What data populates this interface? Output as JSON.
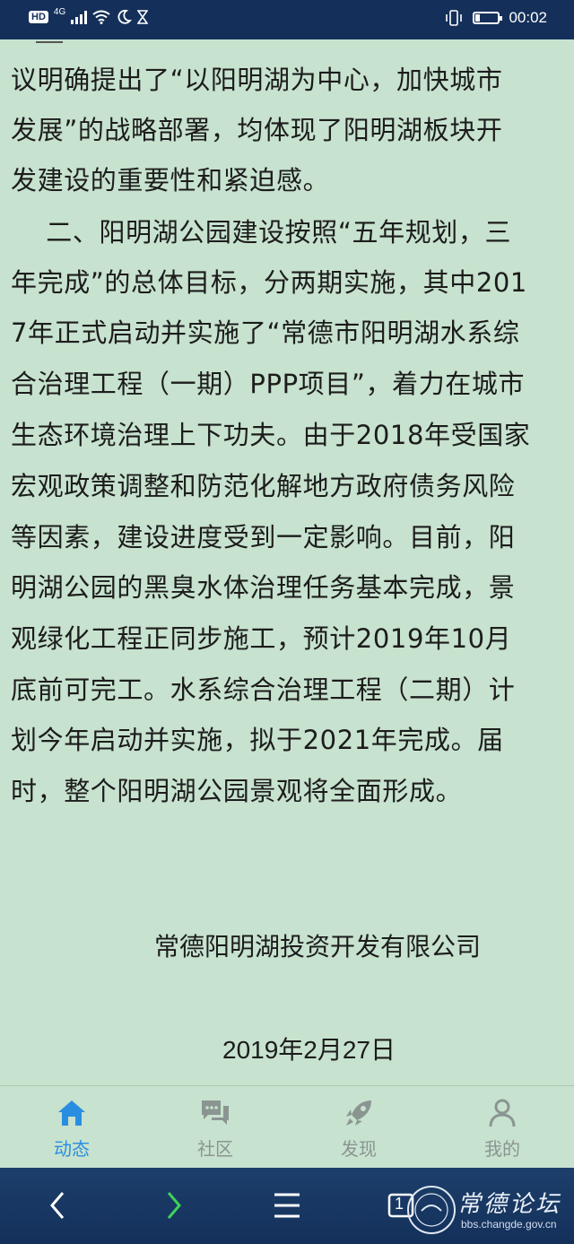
{
  "status_bar": {
    "hd": "HD",
    "network": "4G",
    "time": "00:02",
    "battery_level_percent": 20
  },
  "article": {
    "lines": [
      "议明确提出了“以阳明湖为中心，加快城市",
      "发展”的战略部署，均体现了阳明湖板块开",
      "发建设的重要性和紧迫感。",
      "    二、阳明湖公园建设按照“五年规划，三",
      "年完成”的总体目标，分两期实施，其中201",
      "7年正式启动并实施了“常德市阳明湖水系综",
      "合治理工程（一期）PPP项目”，着力在城市",
      "生态环境治理上下功夫。由于2018年受国家",
      "宏观政策调整和防范化解地方政府债务风险",
      "等因素，建设进度受到一定影响。目前，阳",
      "明湖公园的黑臭水体治理任务基本完成，景",
      "观绿化工程正同步施工，预计2019年10月",
      "底前可完工。水系综合治理工程（二期）计",
      "划今年启动并实施，拟于2021年完成。届",
      "时，整个阳明湖公园景观将全面形成。"
    ],
    "signature": "常德阳明湖投资开发有限公司",
    "date": "2019年2月27日"
  },
  "tabs": [
    {
      "label": "动态",
      "icon": "home-icon",
      "active": true
    },
    {
      "label": "社区",
      "icon": "chat-bubbles-icon",
      "active": false
    },
    {
      "label": "发现",
      "icon": "rocket-icon",
      "active": false
    },
    {
      "label": "我的",
      "icon": "user-icon",
      "active": false
    }
  ],
  "navbar": {
    "tab_count": "1"
  },
  "watermark": {
    "title": "常德论坛",
    "url": "bbs.changde.gov.cn"
  },
  "colors": {
    "background": "#c7e2ce",
    "status_bar": "#14305a",
    "active_tab": "#2a8ee0",
    "inactive_tab": "#8a9591"
  }
}
